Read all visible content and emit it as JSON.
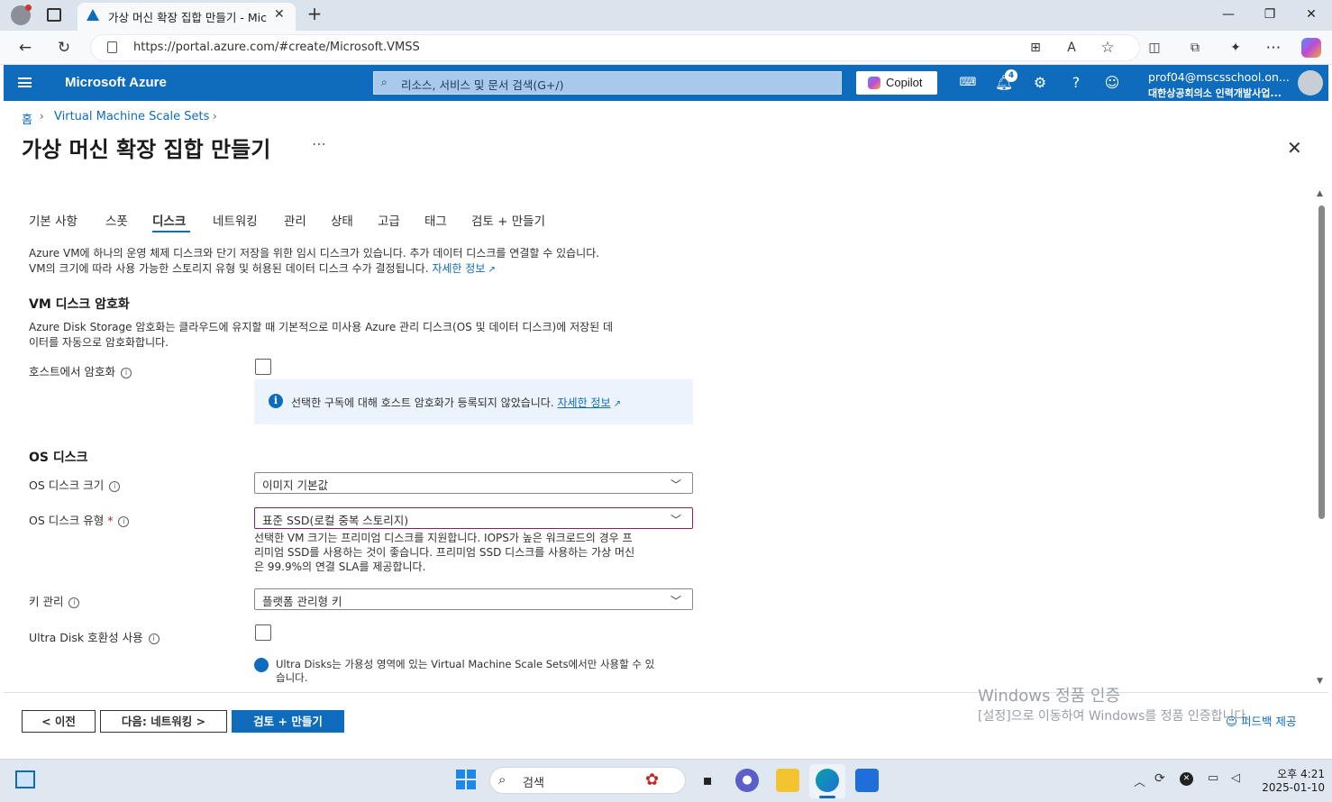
{
  "browser": {
    "tab_title": "가상 머신 확장 집합 만들기 - Mic",
    "url": "https://portal.azure.com/#create/Microsoft.VMSS"
  },
  "azure": {
    "brand": "Microsoft Azure",
    "search_placeholder": "리소스, 서비스 및 문서 검색(G+/)",
    "copilot_label": "Copilot",
    "notification_count": "4",
    "user_email": "prof04@mscsschool.on...",
    "user_org": "대한상공회의소 인력개발사업..."
  },
  "breadcrumb": [
    "홈",
    "Virtual Machine Scale Sets"
  ],
  "page_title": "가상 머신 확장 집합 만들기",
  "tabs": [
    "기본 사항",
    "스폿",
    "디스크",
    "네트워킹",
    "관리",
    "상태",
    "고급",
    "태그",
    "검토 + 만들기"
  ],
  "active_tab": "디스크",
  "intro": {
    "line1": "Azure VM에 하나의 운영 체제 디스크와 단기 저장을 위한 임시 디스크가 있습니다. 추가 데이터 디스크를 연결할 수 있습니다.",
    "line2": "VM의 크기에 따라 사용 가능한 스토리지 유형 및 허용된 데이터 디스크 수가 결정됩니다.",
    "link": "자세한 정보"
  },
  "encryption": {
    "heading": "VM 디스크 암호화",
    "desc1": "Azure Disk Storage 암호화는 클라우드에 유지할 때 기본적으로 미사용 Azure 관리 디스크(OS 및 데이터 디스크)에 저장된 데",
    "desc2": "이터를 자동으로 암호화합니다.",
    "host_label": "호스트에서 암호화",
    "host_checked": false,
    "info_text": "선택한 구독에 대해 호스트 암호화가 등록되지 않았습니다.",
    "info_link": "자세한 정보"
  },
  "os_disk": {
    "heading": "OS 디스크",
    "size_label": "OS 디스크 크기",
    "size_value": "이미지 기본값",
    "type_label": "OS 디스크 유형",
    "type_required": "*",
    "type_value": "표준 SSD(로컬 중복 스토리지)",
    "type_help1": "선택한 VM 크기는 프리미엄 디스크를 지원합니다. IOPS가 높은 워크로드의 경우 프",
    "type_help2": "리미엄 SSD를 사용하는 것이 좋습니다. 프리미엄 SSD 디스크를 사용하는 가상 머신",
    "type_help3": "은 99.9%의 연결 SLA를 제공합니다.",
    "key_label": "키 관리",
    "key_value": "플랫폼 관리형 키",
    "ultra_label": "Ultra Disk 호환성 사용",
    "ultra_checked": false,
    "ultra_info1": "Ultra Disks는 가용성 영역에 있는 Virtual Machine Scale Sets에서만 사용할 수 있",
    "ultra_info2": "습니다."
  },
  "footer": {
    "prev": "< 이전",
    "next": "다음: 네트워킹 >",
    "review": "검토 + 만들기",
    "feedback": "피드백 제공"
  },
  "watermark": {
    "line1": "Windows 정품 인증",
    "line2": "[설정]으로 이동하여 Windows를 정품 인증합니다."
  },
  "taskbar": {
    "search": "검색",
    "time": "오후 4:21",
    "date": "2025-01-10"
  },
  "colors": {
    "azure_blue": "#0f6cbd",
    "required": "#a4262c"
  }
}
